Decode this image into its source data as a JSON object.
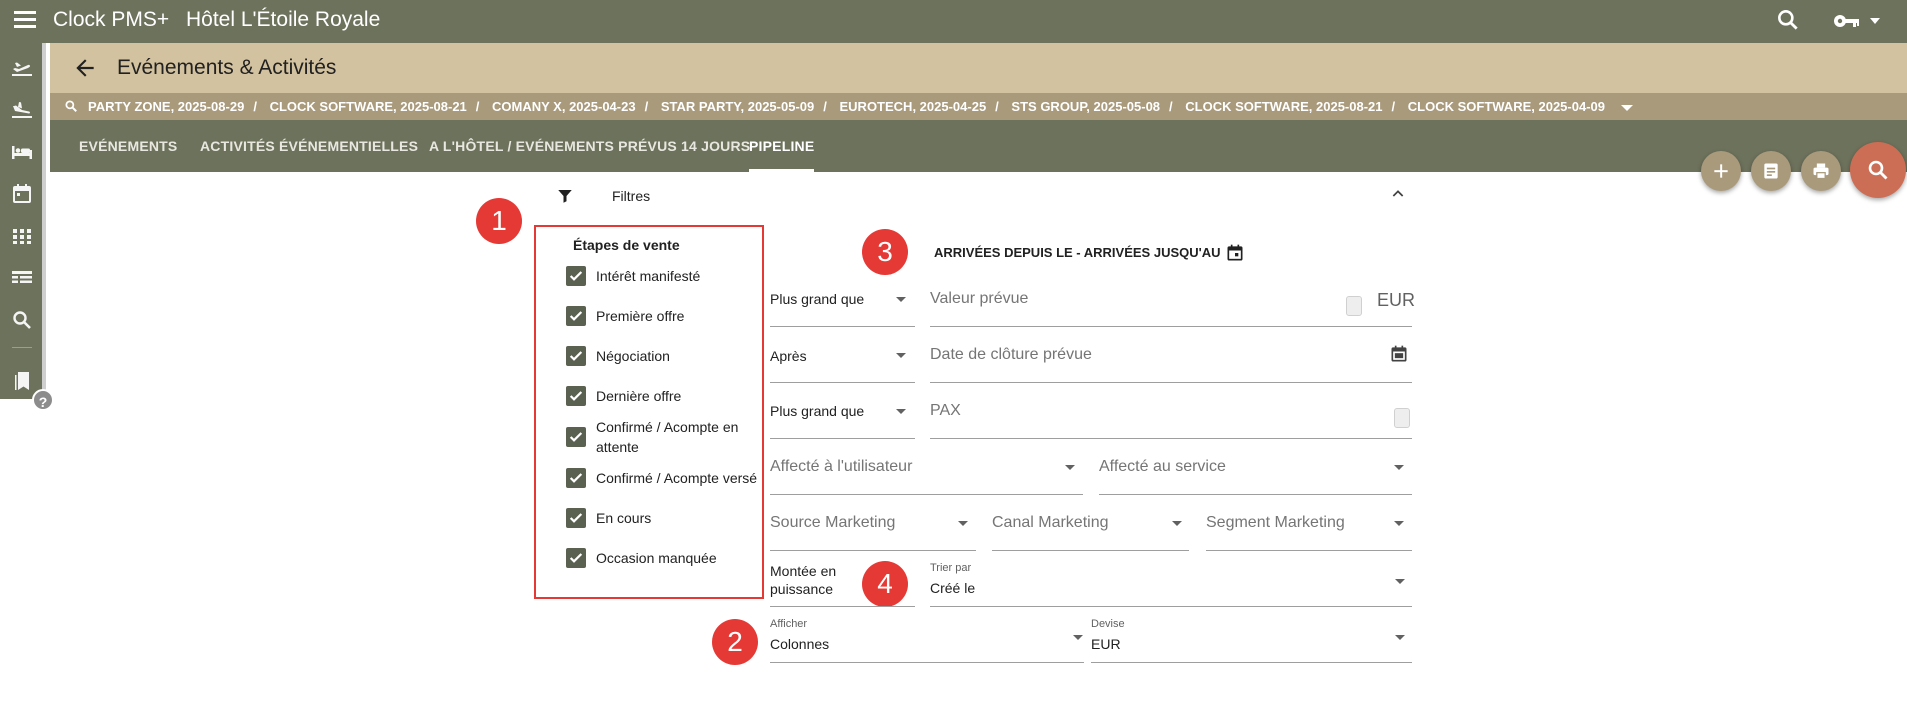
{
  "app": {
    "name": "Clock PMS+",
    "hotel": "Hôtel L'Étoile Royale"
  },
  "header": {
    "title": "Evénements & Activités"
  },
  "breadcrumbs": [
    "PARTY ZONE, 2025-08-29",
    "CLOCK SOFTWARE, 2025-08-21",
    "COMANY X, 2025-04-23",
    "STAR PARTY, 2025-05-09",
    "EUROTECH, 2025-04-25",
    "STS GROUP, 2025-05-08",
    "CLOCK SOFTWARE, 2025-08-21",
    "CLOCK SOFTWARE, 2025-04-09"
  ],
  "tabs": [
    {
      "label": "EVÉNEMENTS"
    },
    {
      "label": "ACTIVITÉS ÉVÉNEMENTIELLES"
    },
    {
      "label": "A L'HÔTEL / EVÉNEMENTS PRÉVUS 14 JOURS"
    },
    {
      "label": "PIPELINE"
    }
  ],
  "filters": {
    "label": "Filtres",
    "stages_title": "Étapes de vente",
    "stages": [
      {
        "label": "Intérêt manifesté",
        "checked": true
      },
      {
        "label": "Première offre",
        "checked": true
      },
      {
        "label": "Négociation",
        "checked": true
      },
      {
        "label": "Dernière offre",
        "checked": true
      },
      {
        "label": "Confirmé / Acompte en attente",
        "checked": true
      },
      {
        "label": "Confirmé / Acompte versé",
        "checked": true
      },
      {
        "label": "En cours",
        "checked": true
      },
      {
        "label": "Occasion manquée",
        "checked": true
      }
    ],
    "date_range_label": "ARRIVÉES DEPUIS LE - ARRIVÉES JUSQU'AU",
    "value_op": "Plus grand que",
    "value_placeholder": "Valeur prévue",
    "currency_suffix": "EUR",
    "close_op": "Après",
    "close_placeholder": "Date de clôture prévue",
    "pax_op": "Plus grand que",
    "pax_placeholder": "PAX",
    "assigned_user": "Affecté à l'utilisateur",
    "assigned_service": "Affecté au service",
    "source": "Source Marketing",
    "channel": "Canal Marketing",
    "segment": "Segment Marketing",
    "rampup": "Montée en puissance",
    "sort_label": "Trier par",
    "sort_value": "Créé le",
    "display_label": "Afficher",
    "display_value": "Colonnes",
    "currency_label": "Devise",
    "currency_value": "EUR"
  },
  "markers": [
    "1",
    "2",
    "3",
    "4"
  ],
  "colors": {
    "topbar": "#6d725c",
    "header": "#d3c29f",
    "crumbs": "#a99a7c",
    "accent_red": "#e53935",
    "search_fab": "#cc6e55"
  }
}
